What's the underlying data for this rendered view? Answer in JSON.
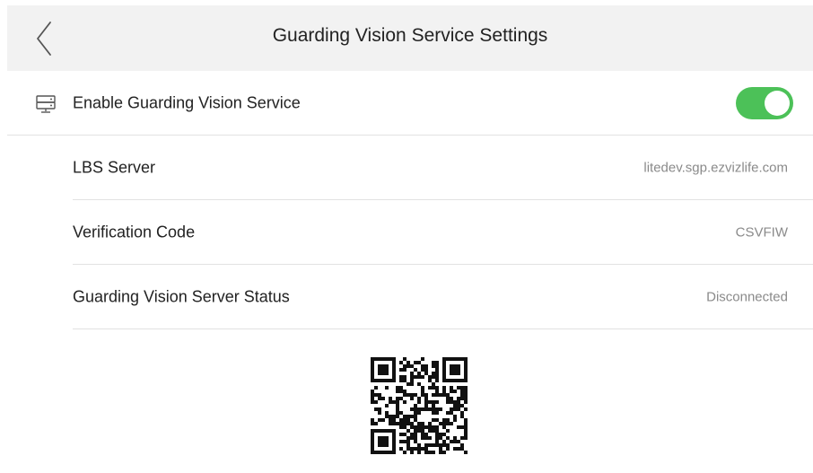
{
  "header": {
    "title": "Guarding Vision Service Settings"
  },
  "enable_service": {
    "label": "Enable Guarding Vision Service",
    "toggle_on": true,
    "toggle_color": "#4cc158"
  },
  "settings": [
    {
      "label": "LBS Server",
      "value": "litedev.sgp.ezvizlife.com"
    },
    {
      "label": "Verification Code",
      "value": "CSVFIW"
    },
    {
      "label": "Guarding Vision Server Status",
      "value": "Disconnected"
    }
  ],
  "icons": {
    "back": "chevron-left-icon",
    "server": "server-icon",
    "qr": "qr-code-icon"
  }
}
